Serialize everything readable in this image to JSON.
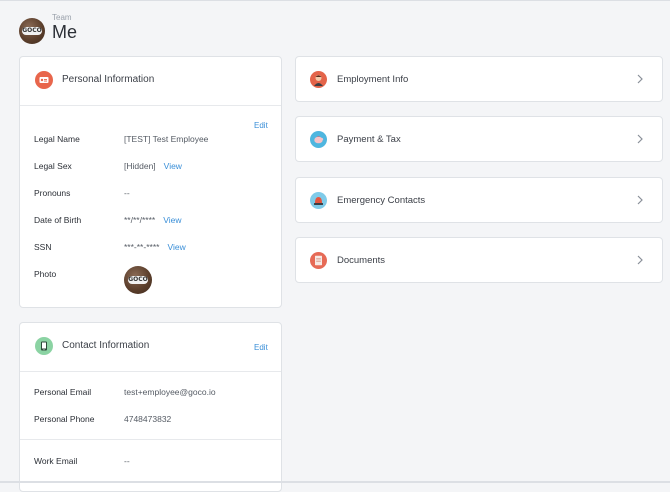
{
  "header": {
    "breadcrumb": "Team",
    "title": "Me",
    "avatar_badge": "GOCO"
  },
  "personal_info": {
    "title": "Personal Information",
    "edit_label": "Edit",
    "fields": [
      {
        "label": "Legal Name",
        "value": "[TEST] Test Employee"
      },
      {
        "label": "Legal Sex",
        "value": "[Hidden]",
        "action": "View"
      },
      {
        "label": "Pronouns",
        "value": "--"
      },
      {
        "label": "Date of Birth",
        "value": "**/**/****",
        "action": "View"
      },
      {
        "label": "SSN",
        "value": "***-**-****",
        "action": "View"
      },
      {
        "label": "Photo"
      }
    ]
  },
  "contact_info": {
    "title": "Contact Information",
    "edit_label": "Edit",
    "fields": [
      {
        "label": "Personal Email",
        "value": "test+employee@goco.io"
      },
      {
        "label": "Personal Phone",
        "value": "4748473832"
      },
      {
        "label": "Work Email",
        "value": "--"
      }
    ]
  },
  "sections": [
    {
      "label": "Employment Info",
      "icon": "employment-icon",
      "color": "#e4644a"
    },
    {
      "label": "Payment & Tax",
      "icon": "piggy-bank-icon",
      "color": "#4fb6df"
    },
    {
      "label": "Emergency Contacts",
      "icon": "siren-icon",
      "color": "#7fcbe9"
    },
    {
      "label": "Documents",
      "icon": "document-icon",
      "color": "#e66a56"
    }
  ],
  "colors": {
    "accent_link": "#3a8fd8",
    "personal_icon": "#e8664c",
    "contact_icon": "#8bd3a3"
  }
}
